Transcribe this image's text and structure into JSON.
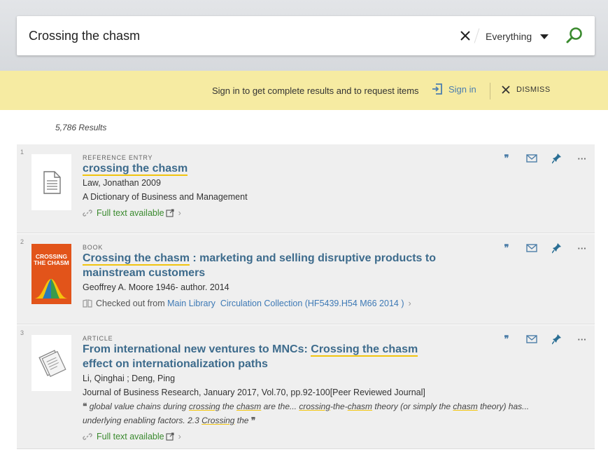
{
  "search": {
    "query": "Crossing the chasm",
    "scope": "Everything",
    "clear_label": "×"
  },
  "signin_bar": {
    "message": "Sign in to get complete results and to request items",
    "signin_label": "Sign in",
    "dismiss_label": "DISMISS"
  },
  "results_count": "5,786 Results",
  "colors": {
    "accent": "#3d6b8c",
    "highlight": "#f1c40f",
    "available": "#3a8a2e",
    "banner": "#f6eba2"
  },
  "results": [
    {
      "index": "1",
      "type": "REFERENCE ENTRY",
      "title_hl": "crossing the chasm",
      "title_rest": "",
      "author": "Law, Jonathan 2009",
      "source": "A Dictionary of Business and Management",
      "availability": "Full text available"
    },
    {
      "index": "2",
      "type": "BOOK",
      "title_hl": "Crossing the chasm",
      "title_rest": " : marketing and selling disruptive products to mainstream customers",
      "author": "Geoffrey A. Moore 1946- author. 2014",
      "availability_prefix": "Checked out from ",
      "availability_link": "Main Library  Circulation Collection (HF5439.H54 M66 2014 )",
      "cover_text": "CROSSING THE CHASM"
    },
    {
      "index": "3",
      "type": "ARTICLE",
      "title_pre": "From international new ventures to MNCs: ",
      "title_hl": "Crossing the chasm",
      "title_rest": " effect on internationalization paths",
      "author": "Li, Qinghai ; Deng, Ping",
      "source": "Journal of Business Research, January 2017, Vol.70, pp.92-100[Peer Reviewed Journal]",
      "snippet": {
        "s1": " global value chains during ",
        "u1": "crossing",
        "s2": " the ",
        "u2": "chasm",
        "s3": " are the... ",
        "u3": "crossing",
        "s4": "-the-",
        "u4": "chasm",
        "s5": " theory (or simply the ",
        "u5": "chasm",
        "s6": " theory) has... underlying enabling factors. 2.3 ",
        "u6": "Crossing",
        "s7": " the "
      },
      "availability": "Full text available"
    }
  ]
}
